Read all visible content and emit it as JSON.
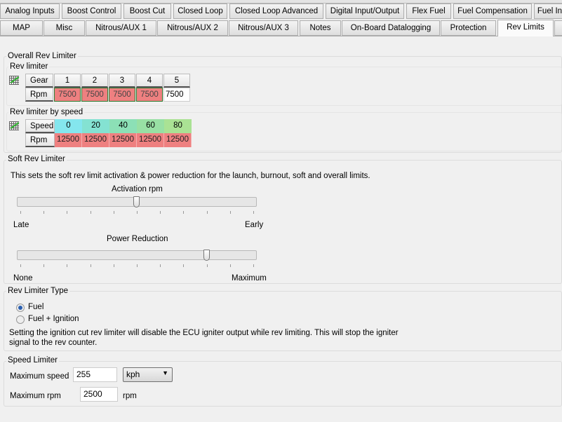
{
  "tabs_row1": [
    "Analog Inputs",
    "Boost Control",
    "Boost Cut",
    "Closed Loop",
    "Closed Loop Advanced",
    "Digital Input/Output",
    "Flex Fuel",
    "Fuel Compensation",
    "Fuel In"
  ],
  "tabs_row2": [
    "MAP",
    "Misc",
    "Nitrous/AUX 1",
    "Nitrous/AUX 2",
    "Nitrous/AUX 3",
    "Notes",
    "On-Board Datalogging",
    "Protection",
    "Rev Limits"
  ],
  "active_tab": "Rev Limits",
  "overall": {
    "title": "Overall Rev Limiter",
    "rev_limiter": {
      "title": "Rev limiter",
      "row_header": "Gear",
      "row_value": "Rpm",
      "gears": [
        "1",
        "2",
        "3",
        "4",
        "5"
      ],
      "rpm": [
        "7500",
        "7500",
        "7500",
        "7500",
        "7500"
      ]
    },
    "by_speed": {
      "title": "Rev limiter by speed",
      "row_header": "Speed",
      "row_value": "Rpm",
      "speeds": [
        "0",
        "20",
        "40",
        "60",
        "80"
      ],
      "rpm": [
        "12500",
        "12500",
        "12500",
        "12500",
        "12500"
      ],
      "speed_colors": [
        "#84e6ee",
        "#84e2d2",
        "#8ce0b6",
        "#98e0a4",
        "#aae294"
      ],
      "rpm_color": "#ee8080"
    }
  },
  "soft": {
    "title": "Soft Rev Limiter",
    "description": "This sets the soft rev limit activation & power reduction for the launch, burnout, soft and overall limits.",
    "activation": {
      "label": "Activation rpm",
      "min_label": "Late",
      "max_label": "Early",
      "value_fraction": 0.5
    },
    "power": {
      "label": "Power Reduction",
      "min_label": "None",
      "max_label": "Maximum",
      "value_fraction": 0.8
    }
  },
  "type": {
    "title": "Rev Limiter Type",
    "options": [
      {
        "label": "Fuel",
        "selected": true
      },
      {
        "label": "Fuel + Ignition",
        "selected": false
      }
    ],
    "note": "Setting the ignition cut rev limiter will disable the  ECU igniter output while rev limiting.  This will stop the igniter signal to the rev counter."
  },
  "speed_limiter": {
    "title": "Speed Limiter",
    "max_speed_label": "Maximum speed",
    "max_speed": "255",
    "unit_select": "kph",
    "max_rpm_label": "Maximum rpm",
    "max_rpm": "2500",
    "rpm_unit": "rpm"
  }
}
